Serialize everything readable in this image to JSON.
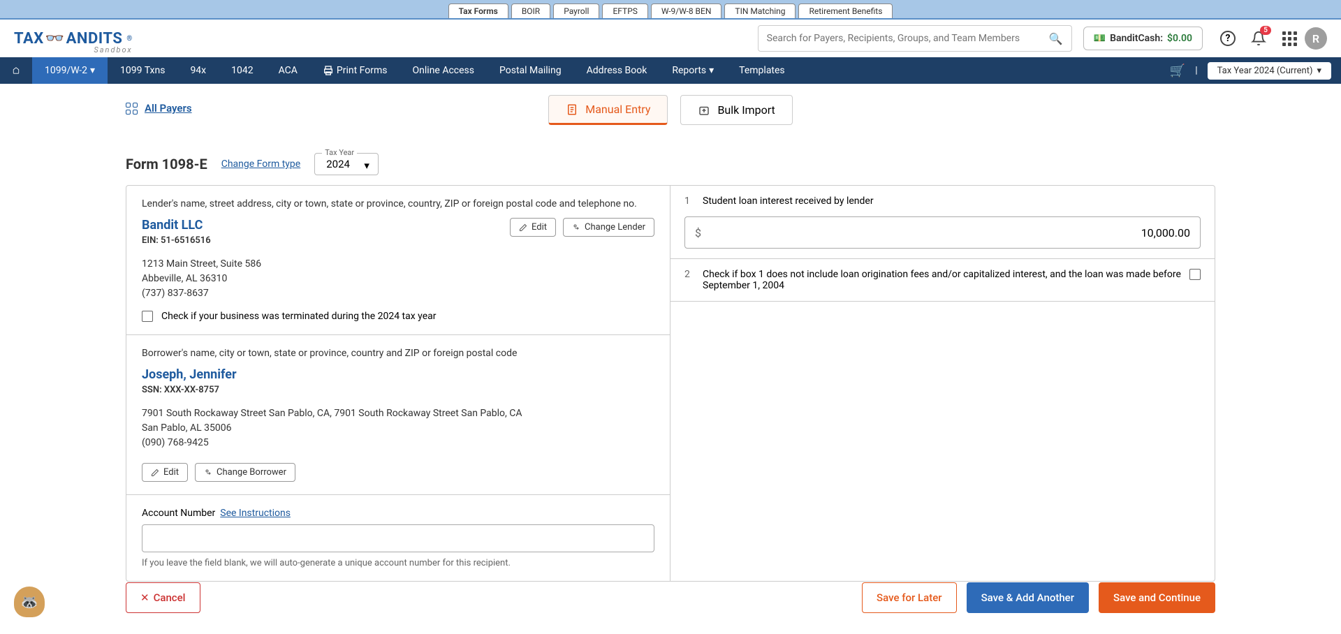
{
  "topTabs": [
    "Tax Forms",
    "BOIR",
    "Payroll",
    "EFTPS",
    "W-9/W-8 BEN",
    "TIN Matching",
    "Retirement Benefits"
  ],
  "topTabActive": 0,
  "logo": {
    "pre": "TAX",
    "post": "ANDITS",
    "sandbox": "Sandbox",
    "reg": "®"
  },
  "search": {
    "placeholder": "Search for Payers, Recipients, Groups, and Team Members"
  },
  "banditCash": {
    "label": "BanditCash:",
    "amount": "$0.00"
  },
  "notification": {
    "count": "5"
  },
  "avatar": {
    "initial": "R"
  },
  "nav": {
    "items": [
      "1099/W-2",
      "1099 Txns",
      "94x",
      "1042",
      "ACA",
      "Print Forms",
      "Online Access",
      "Postal Mailing",
      "Address Book",
      "Reports",
      "Templates"
    ],
    "activeIndex": 0,
    "printIcon": 5,
    "dropdownIndices": [
      0,
      9
    ],
    "taxYear": "Tax Year 2024 (Current)"
  },
  "allPayers": "All Payers",
  "entryTabs": {
    "manual": "Manual Entry",
    "bulk": "Bulk Import"
  },
  "formHead": {
    "title": "Form 1098-E",
    "change": "Change Form type",
    "year": "2024",
    "yearLabel": "Tax Year"
  },
  "lender": {
    "sectionLabel": "Lender's name, street address, city or town, state or province, country, ZIP or foreign postal code and telephone no.",
    "name": "Bandit LLC",
    "ein": "EIN: 51-6516516",
    "addr1": "1213 Main Street, Suite 586",
    "addr2": "Abbeville, AL 36310",
    "phone": "(737) 837-8637",
    "edit": "Edit",
    "change": "Change Lender",
    "terminatedCheck": "Check if your business was terminated during the 2024 tax year"
  },
  "borrower": {
    "sectionLabel": "Borrower's name, city or town, state or province, country and ZIP or foreign postal code",
    "name": "Joseph, Jennifer",
    "ssn": "SSN: XXX-XX-8757",
    "addr1": "7901 South Rockaway Street San Pablo, CA, 7901 South Rockaway Street San Pablo, CA",
    "addr2": "San Pablo, AL 35006",
    "phone": "(090) 768-9425",
    "edit": "Edit",
    "change": "Change Borrower"
  },
  "account": {
    "label": "Account Number",
    "instructions": "See Instructions",
    "help": "If you leave the field blank, we will auto-generate a unique account number for this recipient.",
    "value": ""
  },
  "box1": {
    "num": "1",
    "label": "Student loan interest received by lender",
    "value": "10,000.00"
  },
  "box2": {
    "num": "2",
    "label": "Check if box 1 does not include loan origination fees and/or capitalized interest, and the loan was made before September 1, 2004"
  },
  "footer": {
    "cancel": "Cancel",
    "saveLater": "Save for Later",
    "saveAdd": "Save & Add Another",
    "saveContinue": "Save and Continue"
  }
}
